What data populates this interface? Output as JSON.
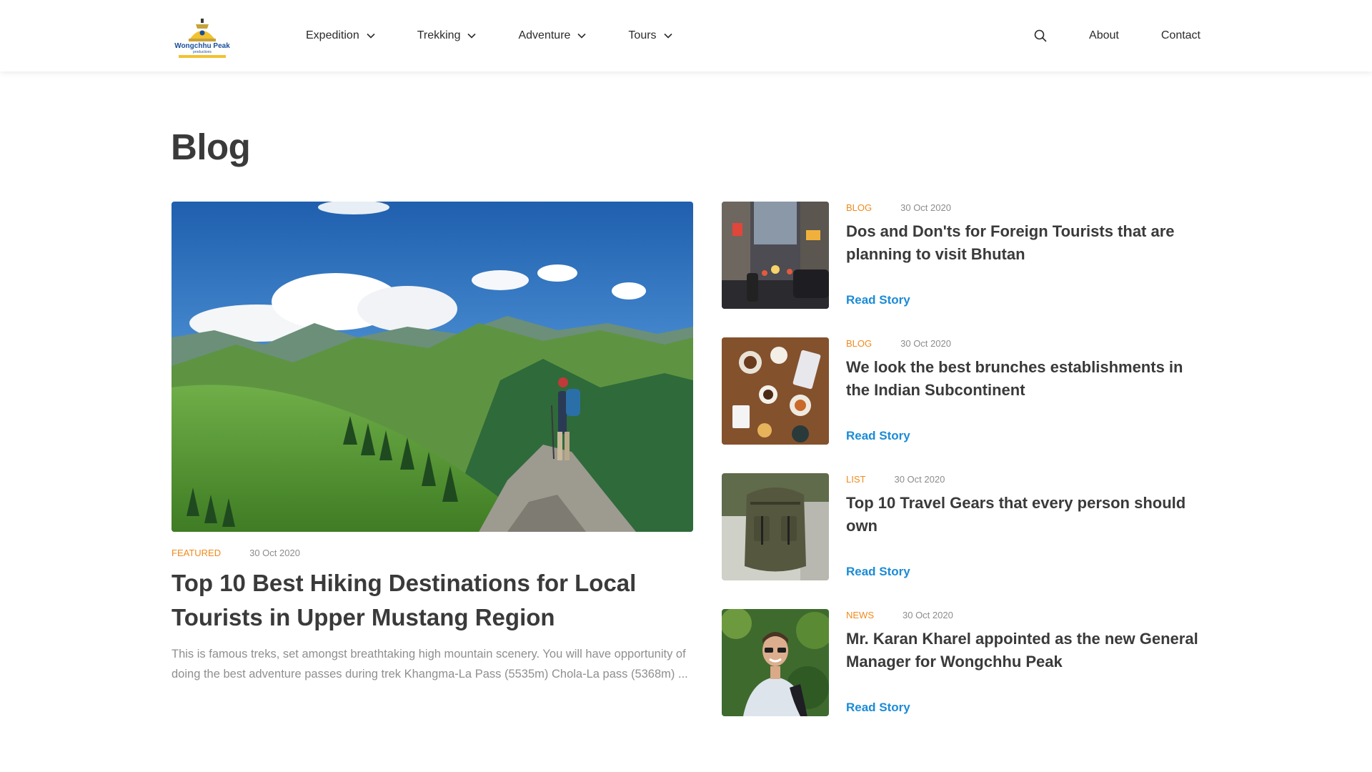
{
  "brand": {
    "logo_text": "Wongchhu Peak",
    "logo_tagline": "productions"
  },
  "nav": {
    "items": [
      {
        "label": "Expedition"
      },
      {
        "label": "Trekking"
      },
      {
        "label": "Adventure"
      },
      {
        "label": "Tours"
      }
    ],
    "about": "About",
    "contact": "Contact"
  },
  "page": {
    "title": "Blog"
  },
  "featured": {
    "category": "FEATURED",
    "date": "30 Oct 2020",
    "title": "Top 10 Best Hiking Destinations for Local Tourists in Upper Mustang Region",
    "excerpt": "This is famous treks, set amongst breathtaking high mountain scenery.  You will have opportunity of doing the best adventure passes during trek Khangma-La Pass (5535m) Chola-La pass (5368m) ..."
  },
  "stories": [
    {
      "category": "BLOG",
      "date": "30 Oct 2020",
      "title": "Dos and Don'ts for Foreign Tourists that are planning to visit Bhutan",
      "read": "Read Story"
    },
    {
      "category": "BLOG",
      "date": "30 Oct 2020",
      "title": "We look the best brunches establishments in the Indian Subcontinent",
      "read": "Read Story"
    },
    {
      "category": "LIST",
      "date": "30 Oct 2020",
      "title": "Top 10 Travel Gears that every person should own",
      "read": "Read Story"
    },
    {
      "category": "NEWS",
      "date": "30 Oct 2020",
      "title": "Mr. Karan Kharel appointed as the new General Manager for Wongchhu Peak",
      "read": "Read Story"
    }
  ],
  "colors": {
    "accent_orange": "#f08a1c",
    "link_blue": "#1b8bd6",
    "text_dark": "#3a3a3a",
    "text_muted": "#8f8f8f"
  }
}
